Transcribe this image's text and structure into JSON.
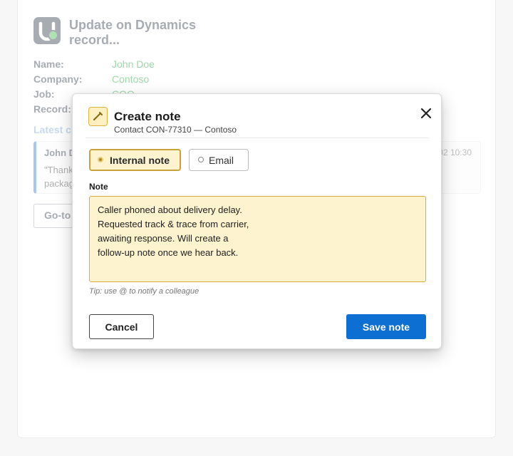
{
  "background": {
    "header_title": "Update on Dynamics record...",
    "fields": [
      {
        "label": "Name:",
        "value": "John Doe"
      },
      {
        "label": "Company:",
        "value": "Contoso"
      },
      {
        "label": "Job:",
        "value": "COO"
      },
      {
        "label": "Record:",
        "value": ""
      }
    ],
    "latest_section_title": "Latest c",
    "entry": {
      "author": "John D",
      "timestamp": "02 10:30",
      "text_line1": "\"Thank",
      "text_line2": "packag"
    },
    "goto_button": "Go-to"
  },
  "modal": {
    "title": "Create note",
    "subtitle": "Contact CON-77310 — Contoso",
    "note_types": [
      {
        "label": "Internal note",
        "selected": true
      },
      {
        "label": "Email",
        "selected": false
      }
    ],
    "note_label": "Note",
    "note_text": "Caller phoned about delivery delay.\nRequested track & trace from carrier,\nawaiting response. Will create a\nfollow-up note once we hear back.",
    "tip": "Tip: use @ to notify a colleague",
    "cancel_label": "Cancel",
    "save_label": "Save note"
  },
  "colors": {
    "primary": "#0d6fd1",
    "note_background": "#fdf3cf",
    "note_border": "#d6ad42",
    "value_green": "#1f9d3a"
  },
  "icons": {
    "app_logo": "u-logo-icon",
    "modal_icon": "pencil-icon",
    "close": "close-icon",
    "radio": "radio-icon"
  }
}
